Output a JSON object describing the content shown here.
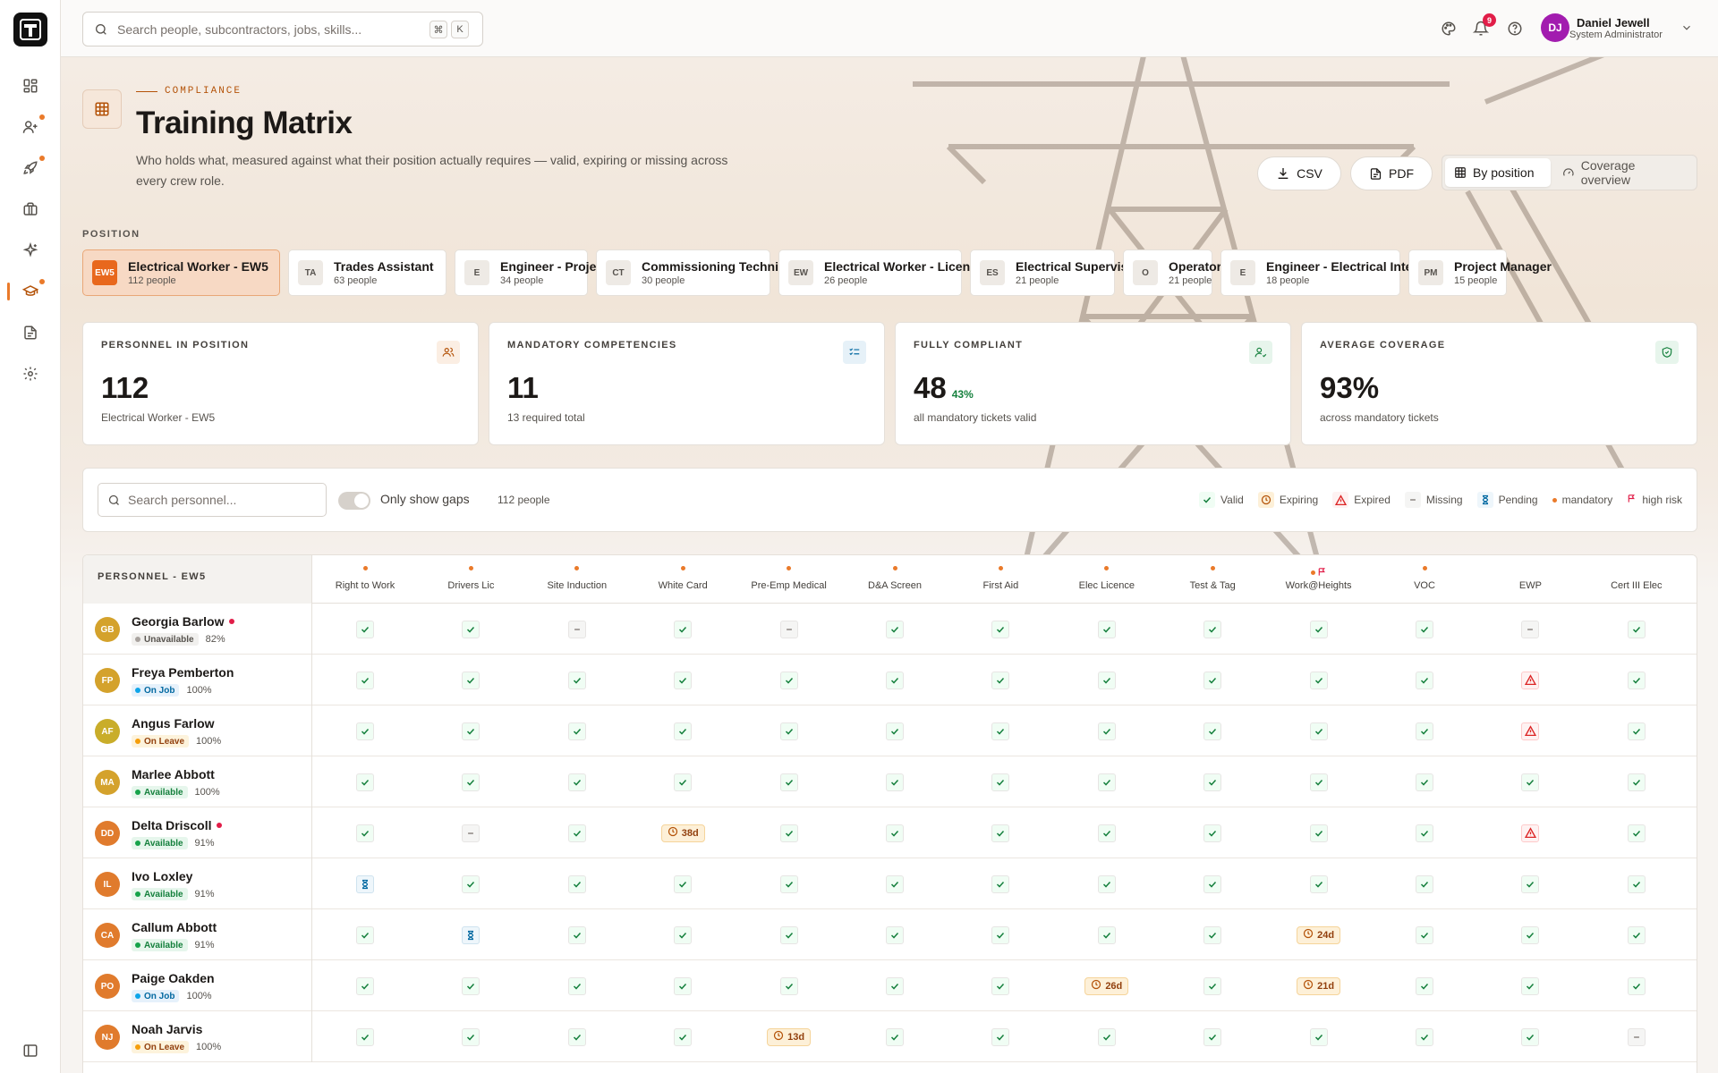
{
  "search": {
    "placeholder": "Search people, subcontractors, jobs, skills...",
    "k1": "⌘",
    "k2": "K"
  },
  "notifications": {
    "count": "9"
  },
  "user": {
    "initials": "DJ",
    "name": "Daniel Jewell",
    "role": "System Administrator"
  },
  "nav": [
    "dashboard-icon",
    "people-icon",
    "rocket-icon",
    "briefcase-icon",
    "sparkle-icon",
    "graduation-cap-icon",
    "document-icon",
    "settings-icon"
  ],
  "header": {
    "eyebrow": "COMPLIANCE",
    "title": "Training Matrix",
    "subtitle": "Who holds what, measured against what their position actually requires — valid, expiring or missing across every crew role."
  },
  "actions": {
    "csv": "CSV",
    "pdf": "PDF",
    "by_position": "By position",
    "coverage": "Coverage overview"
  },
  "positions_label": "POSITION",
  "positions": [
    {
      "abbr": "EW5",
      "name": "Electrical Worker - EW5",
      "count": "112 people"
    },
    {
      "abbr": "TA",
      "name": "Trades Assistant",
      "count": "63 people"
    },
    {
      "abbr": "E",
      "name": "Engineer - Project",
      "count": "34 people"
    },
    {
      "abbr": "CT",
      "name": "Commissioning Technician",
      "count": "30 people"
    },
    {
      "abbr": "EW",
      "name": "Electrical Worker - Licenced",
      "count": "26 people"
    },
    {
      "abbr": "ES",
      "name": "Electrical Supervisor",
      "count": "21 people"
    },
    {
      "abbr": "O",
      "name": "Operator",
      "count": "21 people"
    },
    {
      "abbr": "E",
      "name": "Engineer - Electrical Intern",
      "count": "18 people"
    },
    {
      "abbr": "PM",
      "name": "Project Manager",
      "count": "15 people"
    }
  ],
  "stats": [
    {
      "label": "PERSONNEL IN POSITION",
      "value": "112",
      "pct": "",
      "desc": "Electrical Worker - EW5",
      "icon": "users-icon",
      "color": "#b45309",
      "bg": "#fbeee3"
    },
    {
      "label": "MANDATORY COMPETENCIES",
      "value": "11",
      "pct": "",
      "desc": "13 required total",
      "icon": "checklist-icon",
      "color": "#0369a1",
      "bg": "#e6f1f8"
    },
    {
      "label": "FULLY COMPLIANT",
      "value": "48",
      "pct": "43%",
      "desc": "all mandatory tickets valid",
      "icon": "user-check-icon",
      "color": "#15803d",
      "bg": "#e7f5ec"
    },
    {
      "label": "AVERAGE COVERAGE",
      "value": "93%",
      "pct": "",
      "desc": "across mandatory tickets",
      "icon": "shield-check-icon",
      "color": "#15803d",
      "bg": "#e7f5ec"
    }
  ],
  "filter": {
    "placeholder": "Search personnel...",
    "toggle_label": "Only show gaps",
    "count": "112 people"
  },
  "legend": [
    {
      "key": "valid",
      "label": "Valid"
    },
    {
      "key": "expiring",
      "label": "Expiring"
    },
    {
      "key": "expired",
      "label": "Expired"
    },
    {
      "key": "missing",
      "label": "Missing"
    },
    {
      "key": "pending",
      "label": "Pending"
    },
    {
      "key": "mandatory",
      "label": "mandatory"
    },
    {
      "key": "highrisk",
      "label": "high risk"
    }
  ],
  "matrix": {
    "personnel_header": "PERSONNEL - EW5",
    "columns": [
      {
        "name": "Right to Work",
        "mandatory": true,
        "high_risk": false
      },
      {
        "name": "Drivers Lic",
        "mandatory": true,
        "high_risk": false
      },
      {
        "name": "Site Induction",
        "mandatory": true,
        "high_risk": false
      },
      {
        "name": "White Card",
        "mandatory": true,
        "high_risk": false
      },
      {
        "name": "Pre-Emp Medical",
        "mandatory": true,
        "high_risk": false
      },
      {
        "name": "D&A Screen",
        "mandatory": true,
        "high_risk": false
      },
      {
        "name": "First Aid",
        "mandatory": true,
        "high_risk": false
      },
      {
        "name": "Elec Licence",
        "mandatory": true,
        "high_risk": false
      },
      {
        "name": "Test & Tag",
        "mandatory": true,
        "high_risk": false
      },
      {
        "name": "Work@Heights",
        "mandatory": true,
        "high_risk": true
      },
      {
        "name": "VOC",
        "mandatory": true,
        "high_risk": false
      },
      {
        "name": "EWP",
        "mandatory": false,
        "high_risk": false
      },
      {
        "name": "Cert III Elec",
        "mandatory": false,
        "high_risk": false
      }
    ],
    "rows": [
      {
        "initials": "GB",
        "name": "Georgia Barlow",
        "flag": true,
        "avatar": "#d4a22c",
        "status": "Unavailable",
        "status_key": "unavailable",
        "pct": "82%",
        "cells": [
          "v",
          "v",
          "m",
          "v",
          "m",
          "v",
          "v",
          "v",
          "v",
          "v",
          "v",
          "m",
          "v"
        ]
      },
      {
        "initials": "FP",
        "name": "Freya Pemberton",
        "flag": false,
        "avatar": "#d4a22c",
        "status": "On Job",
        "status_key": "onjob",
        "pct": "100%",
        "cells": [
          "v",
          "v",
          "v",
          "v",
          "v",
          "v",
          "v",
          "v",
          "v",
          "v",
          "v",
          "x",
          "v"
        ]
      },
      {
        "initials": "AF",
        "name": "Angus Farlow",
        "flag": false,
        "avatar": "#c9ad2a",
        "status": "On Leave",
        "status_key": "onleave",
        "pct": "100%",
        "cells": [
          "v",
          "v",
          "v",
          "v",
          "v",
          "v",
          "v",
          "v",
          "v",
          "v",
          "v",
          "x",
          "v"
        ]
      },
      {
        "initials": "MA",
        "name": "Marlee Abbott",
        "flag": false,
        "avatar": "#d4a22c",
        "status": "Available",
        "status_key": "available",
        "pct": "100%",
        "cells": [
          "v",
          "v",
          "v",
          "v",
          "v",
          "v",
          "v",
          "v",
          "v",
          "v",
          "v",
          "v",
          "v"
        ]
      },
      {
        "initials": "DD",
        "name": "Delta Driscoll",
        "flag": true,
        "avatar": "#e07b2d",
        "status": "Available",
        "status_key": "available",
        "pct": "91%",
        "cells": [
          "v",
          "m",
          "v",
          "e:38d",
          "v",
          "v",
          "v",
          "v",
          "v",
          "v",
          "v",
          "x",
          "v"
        ]
      },
      {
        "initials": "IL",
        "name": "Ivo Loxley",
        "flag": false,
        "avatar": "#e07b2d",
        "status": "Available",
        "status_key": "available",
        "pct": "91%",
        "cells": [
          "p",
          "v",
          "v",
          "v",
          "v",
          "v",
          "v",
          "v",
          "v",
          "v",
          "v",
          "v",
          "v"
        ]
      },
      {
        "initials": "CA",
        "name": "Callum Abbott",
        "flag": false,
        "avatar": "#e07b2d",
        "status": "Available",
        "status_key": "available",
        "pct": "91%",
        "cells": [
          "v",
          "p",
          "v",
          "v",
          "v",
          "v",
          "v",
          "v",
          "v",
          "e:24d",
          "v",
          "v",
          "v"
        ]
      },
      {
        "initials": "PO",
        "name": "Paige Oakden",
        "flag": false,
        "avatar": "#e07b2d",
        "status": "On Job",
        "status_key": "onjob",
        "pct": "100%",
        "cells": [
          "v",
          "v",
          "v",
          "v",
          "v",
          "v",
          "v",
          "e:26d",
          "v",
          "e:21d",
          "v",
          "v",
          "v"
        ]
      },
      {
        "initials": "NJ",
        "name": "Noah Jarvis",
        "flag": false,
        "avatar": "#e07b2d",
        "status": "On Leave",
        "status_key": "onleave",
        "pct": "100%",
        "cells": [
          "v",
          "v",
          "v",
          "v",
          "e:13d",
          "v",
          "v",
          "v",
          "v",
          "v",
          "v",
          "v",
          "m"
        ]
      }
    ]
  }
}
